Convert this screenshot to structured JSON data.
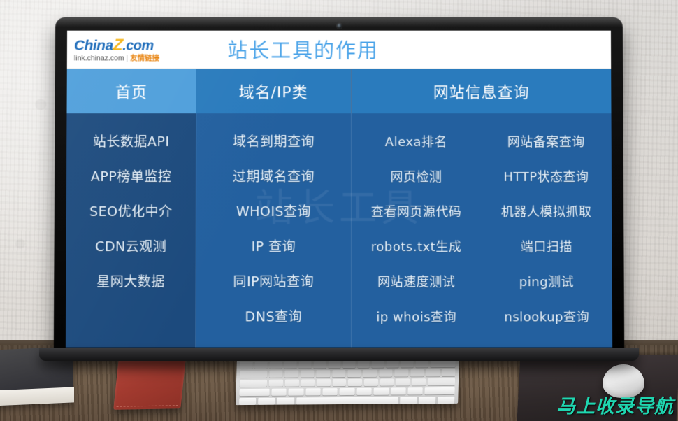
{
  "brand": {
    "logo_main": "China",
    "logo_z": "Z",
    "logo_dotcom": ".com",
    "logo_sub_url": "link.chinaz.com",
    "logo_sub_divider": "|",
    "logo_sub_cn": "友情链接"
  },
  "header": {
    "page_title": "站长工具的作用"
  },
  "nav": {
    "items": [
      {
        "label": "首页",
        "active": true
      },
      {
        "label": "域名/IP类",
        "active": false
      },
      {
        "label": "网站信息查询",
        "active": false
      }
    ]
  },
  "columns": [
    {
      "name": "home-tools",
      "links": [
        "站长数据API",
        "APP榜单监控",
        "SEO优化中介",
        "CDN云观测",
        "星网大数据"
      ]
    },
    {
      "name": "domain-ip-tools",
      "links": [
        "域名到期查询",
        "过期域名查询",
        "WHOIS查询",
        "IP 查询",
        "同IP网站查询",
        "DNS查询"
      ]
    },
    {
      "name": "site-info-tools-a",
      "links": [
        "Alexa排名",
        "网页检测",
        "查看网页源代码",
        "robots.txt生成",
        "网站速度测试",
        "ip whois查询"
      ]
    },
    {
      "name": "site-info-tools-b",
      "links": [
        "网站备案查询",
        "HTTP状态查询",
        "机器人模拟抓取",
        "端口扫描",
        "ping测试",
        "nslookup查询"
      ]
    }
  ],
  "ghost_watermark": "站长工具",
  "watermark": "马上收录导航",
  "colors": {
    "nav_active": "#4f9fdb",
    "nav_inactive": "#2a7bbd",
    "col_first_bg": "#1c4a7d",
    "col_rest_bg": "#23609f",
    "title_blue": "#4aa3e8",
    "logo_blue": "#1667b8",
    "logo_yellow": "#f5b416",
    "logo_orange": "#e8820c",
    "watermark_teal": "#1fd6b0",
    "link_text": "#e9f3fb"
  }
}
